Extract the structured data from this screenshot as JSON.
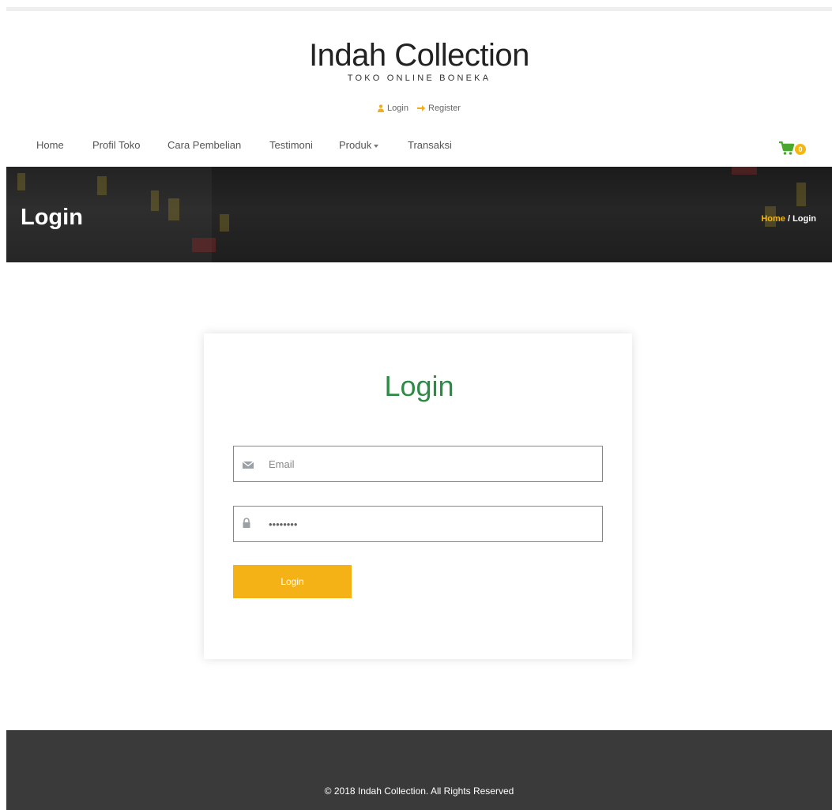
{
  "brand": {
    "title": "Indah Collection",
    "subtitle": "TOKO ONLINE BONEKA"
  },
  "auth": {
    "login_label": "Login",
    "register_label": "Register"
  },
  "nav": {
    "items": [
      {
        "label": "Home"
      },
      {
        "label": "Profil Toko"
      },
      {
        "label": "Cara Pembelian"
      },
      {
        "label": "Testimoni"
      },
      {
        "label": "Produk"
      },
      {
        "label": "Transaksi"
      }
    ]
  },
  "cart": {
    "count": "0",
    "icon": "shopping-cart-icon"
  },
  "hero": {
    "title": "Login",
    "breadcrumb_home": "Home",
    "breadcrumb_sep": " / ",
    "breadcrumb_current": "Login"
  },
  "login_form": {
    "title": "Login",
    "email_placeholder": "Email",
    "email_value": "",
    "password_value": "password",
    "submit_label": "Login"
  },
  "footer": {
    "copyright": "© 2018 Indah Collection. All Rights Reserved"
  },
  "colors": {
    "accent": "#f5b217",
    "title_green": "#2e8b45",
    "footer_bg": "#3a3a3a"
  }
}
